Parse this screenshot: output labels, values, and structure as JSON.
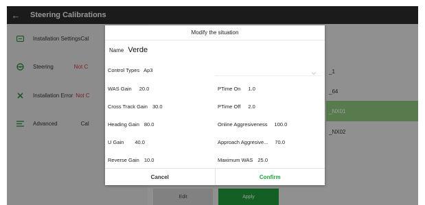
{
  "appbar": {
    "title": "Steering Calibrations",
    "back_icon": "arrow-left-icon"
  },
  "sidebar": {
    "items": [
      {
        "label": "Installation Settings",
        "status": "Cal",
        "icon": "monitor-icon"
      },
      {
        "label": "Steering",
        "status": "Not C",
        "icon": "steering-wheel-icon"
      },
      {
        "label": "Installation Error",
        "status": "Not C",
        "icon": "wrench-icon"
      },
      {
        "label": "Advanced",
        "status": "Cal",
        "icon": "sliders-icon"
      }
    ]
  },
  "profiles": [
    "_1",
    "_64",
    "_NX01",
    "_NX02"
  ],
  "selected_profile_index": 2,
  "background_buttons": {
    "edit": "Edit",
    "apply": "Apply"
  },
  "dialog": {
    "title": "Modify the situation",
    "name_label": "Name",
    "name_value": "Verde",
    "control_types_label": "Control Types",
    "control_types_value": "Ap3",
    "left_params": [
      {
        "label": "WAS Gain",
        "value": "20.0"
      },
      {
        "label": "Cross Track Gain",
        "value": "30.0"
      },
      {
        "label": "Heading Gain",
        "value": "80.0"
      },
      {
        "label": "U Gain",
        "value": "40.0"
      },
      {
        "label": "Reverse Gain",
        "value": "10.0"
      }
    ],
    "right_params": [
      {
        "label": "PTime On",
        "value": "1.0"
      },
      {
        "label": "PTime Off",
        "value": "2.0"
      },
      {
        "label": "Online Aggresiveness",
        "value": "100.0"
      },
      {
        "label": "Approach Aggresive...",
        "value": "70.0"
      },
      {
        "label": "Maximum WAS",
        "value": "25.0"
      }
    ],
    "cancel_label": "Cancel",
    "confirm_label": "Confirm"
  },
  "colors": {
    "accent_green": "#1ea03a",
    "selected_row": "#8fc77f",
    "error_text": "#cc3333",
    "appbar": "#2d2d2d"
  }
}
